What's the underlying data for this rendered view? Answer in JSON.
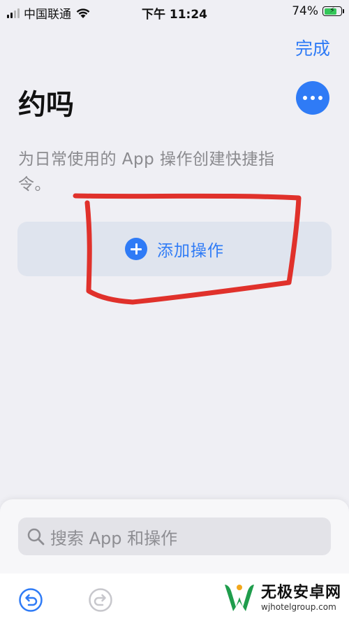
{
  "status_bar": {
    "carrier": "中国联通",
    "time": "下午 11:24",
    "battery_percent": "74%",
    "battery_level": 0.74,
    "charging": true
  },
  "header": {
    "done_label": "完成",
    "title": "约吗"
  },
  "description": "为日常使用的 App 操作创建快捷指令。",
  "add_action": {
    "label": "添加操作"
  },
  "search": {
    "placeholder": "搜索 App 和操作"
  },
  "watermark": {
    "title": "无极安卓网",
    "url": "wjhotelgroup.com"
  },
  "colors": {
    "accent": "#2f7bf6",
    "annotation": "#e0312b",
    "background": "#efeff4",
    "card": "#dfe4ee"
  },
  "icons": {
    "more": "ellipsis-icon",
    "add": "plus-circle-icon",
    "search": "magnifier-icon",
    "undo": "undo-icon",
    "redo": "redo-icon",
    "wifi": "wifi-icon",
    "battery": "battery-charging-icon"
  }
}
